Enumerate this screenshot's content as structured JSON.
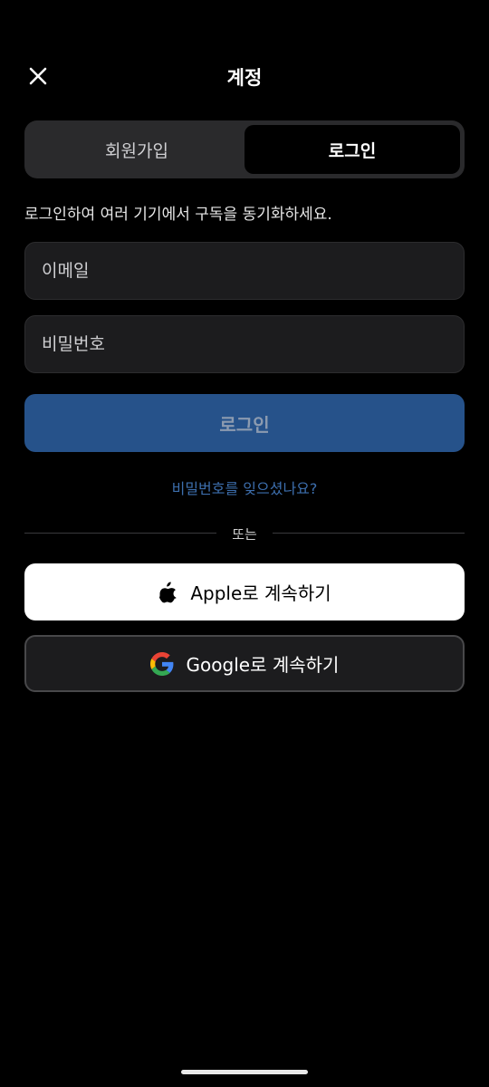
{
  "header": {
    "title": "계정",
    "close_icon": "close-icon"
  },
  "tabs": {
    "signup_label": "회원가입",
    "login_label": "로그인",
    "active": "login"
  },
  "subtitle": "로그인하여 여러 기기에서 구독을 동기화하세요.",
  "form": {
    "email_placeholder": "이메일",
    "email_value": "",
    "password_placeholder": "비밀번호",
    "password_value": "",
    "login_button_label": "로그인",
    "forgot_password_label": "비밀번호를 잊으셨나요?"
  },
  "divider_label": "또는",
  "social": {
    "apple_label": "Apple로 계속하기",
    "apple_icon": "apple-icon",
    "google_label": "Google로 계속하기",
    "google_icon": "google-icon"
  },
  "colors": {
    "background": "#000000",
    "login_button_bg": "#26528a",
    "link": "#3d6fae"
  }
}
